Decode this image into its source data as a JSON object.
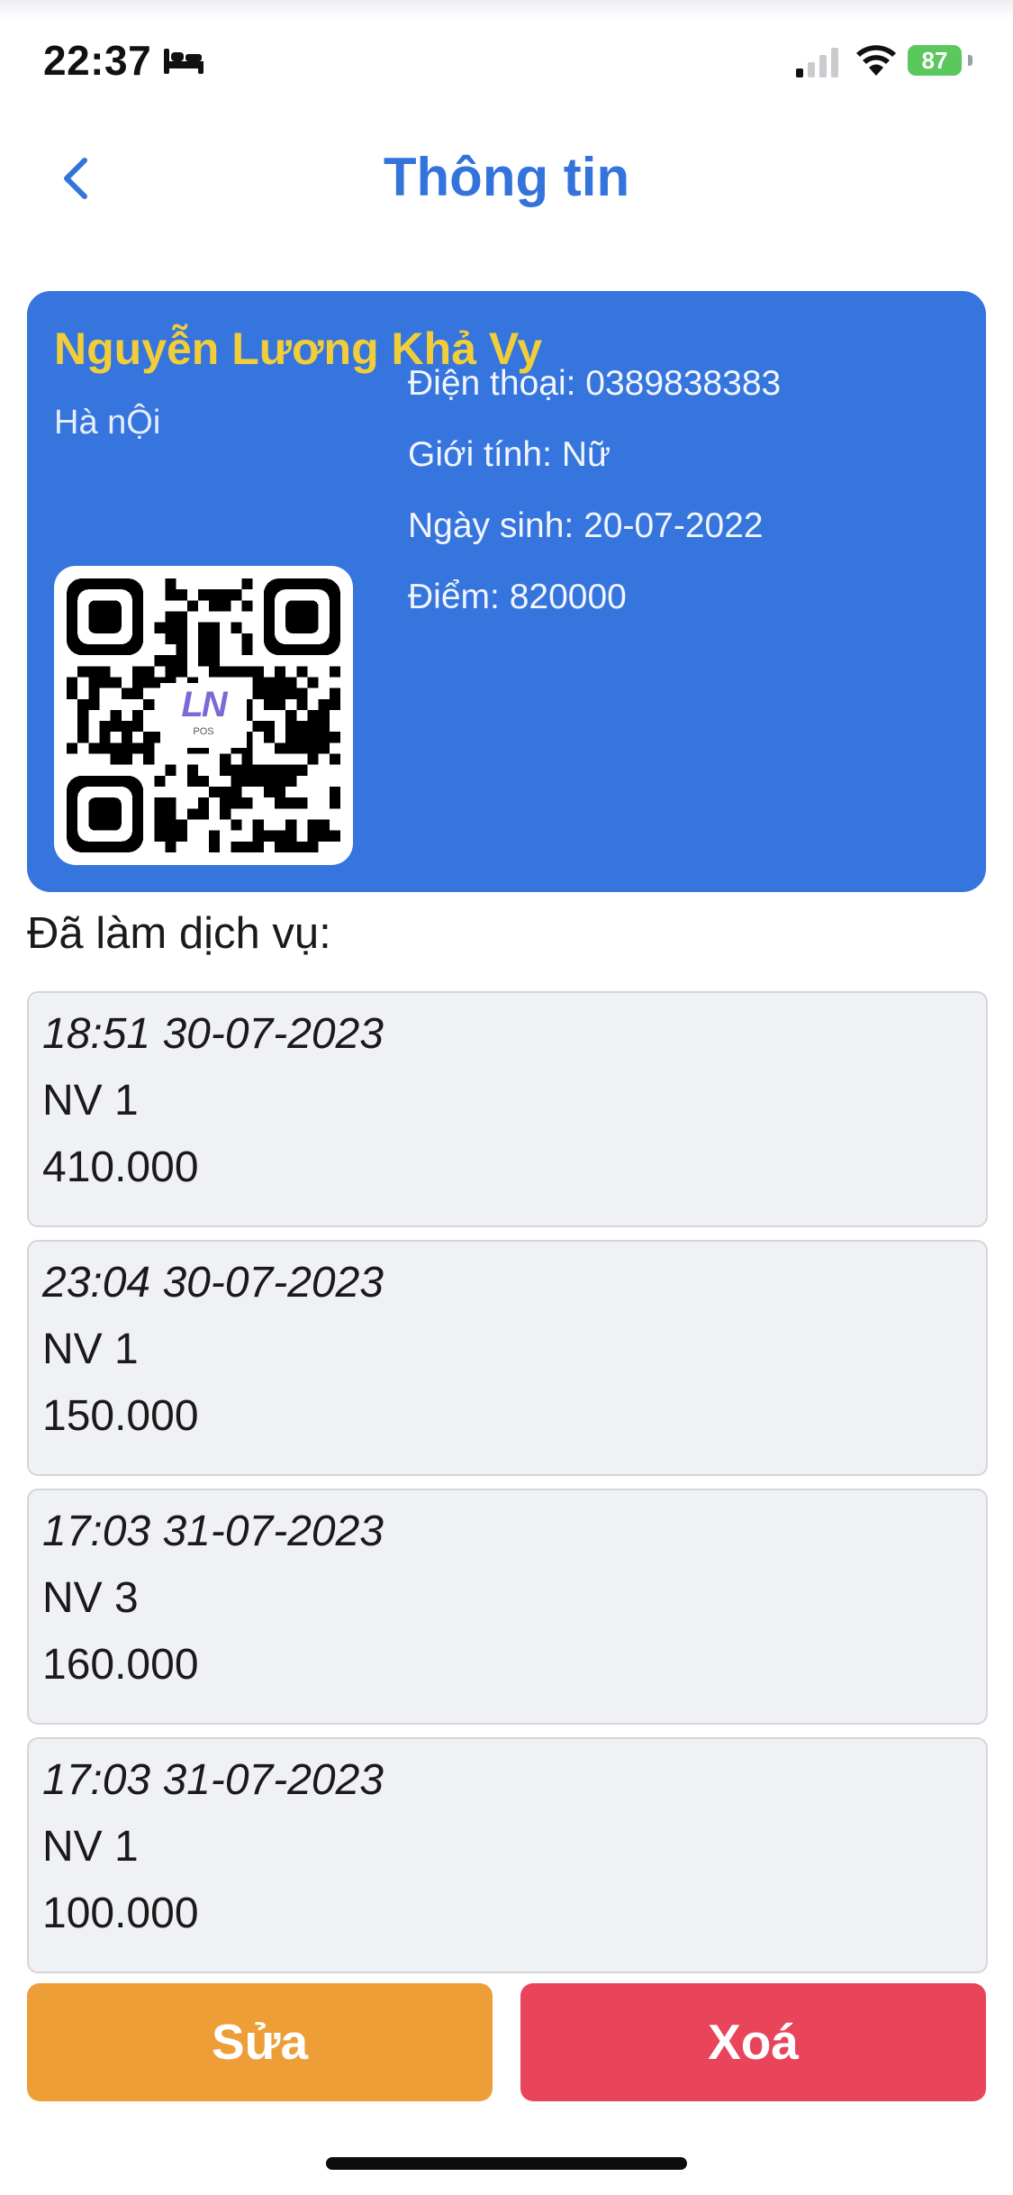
{
  "status_bar": {
    "time": "22:37",
    "battery": "87"
  },
  "header": {
    "title": "Thông tin"
  },
  "customer": {
    "name": "Nguyễn Lương Khả Vy",
    "address": "Hà nỘi",
    "phone_label": "Điện thoại:",
    "phone": "0389838383",
    "gender_label": "Giới tính:",
    "gender": "Nữ",
    "dob_label": "Ngày sinh:",
    "dob": "20-07-2022",
    "points_label": "Điểm:",
    "points": "820000",
    "qr_logo": "LN",
    "qr_logo_sub": "POS"
  },
  "services": {
    "label": "Đã làm dịch vụ:",
    "items": [
      {
        "time": "18:51 30-07-2023",
        "staff": "NV 1",
        "amount": "410.000"
      },
      {
        "time": "23:04 30-07-2023",
        "staff": "NV 1",
        "amount": "150.000"
      },
      {
        "time": "17:03 31-07-2023",
        "staff": "NV 3",
        "amount": "160.000"
      },
      {
        "time": "17:03 31-07-2023",
        "staff": "NV 1",
        "amount": "100.000"
      }
    ]
  },
  "actions": {
    "edit_label": "Sửa",
    "delete_label": "Xoá"
  },
  "colors": {
    "card": "#3575dd",
    "name": "#f2cd3a",
    "title": "#3274db",
    "edit": "#ee9e37",
    "delete": "#e8445a"
  }
}
